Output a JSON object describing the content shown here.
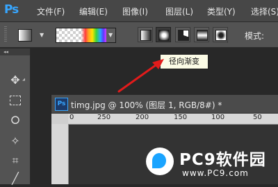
{
  "menubar": {
    "logo": "Ps",
    "items": [
      "文件(F)",
      "编辑(E)",
      "图像(I)",
      "图层(L)",
      "类型(Y)",
      "选择(S)"
    ]
  },
  "options": {
    "tooltip": "径向渐变",
    "mode_label": "模式:",
    "gradient_types": [
      "linear-gradient-icon",
      "radial-gradient-icon",
      "angle-gradient-icon",
      "reflected-gradient-icon",
      "diamond-gradient-icon"
    ],
    "selected_type": "radial-gradient-icon"
  },
  "toolbar": {
    "collapse": "◂◂",
    "tools": [
      "move-tool-icon",
      "marquee-tool-icon",
      "lasso-tool-icon",
      "magic-wand-tool-icon",
      "crop-tool-icon",
      "eyedropper-tool-icon"
    ]
  },
  "document": {
    "icon": "Ps",
    "title": "timg.jpg @ 100% (图层 1, RGB/8#) *",
    "ruler_labels": [
      "0",
      "250",
      "200",
      "150",
      "100",
      "50"
    ]
  },
  "watermark": {
    "name": "PC9软件园",
    "url": "www.PC9.com"
  },
  "colors": {
    "ps_blue": "#37a6ff",
    "arrow_red": "#e21b1b",
    "tooltip_bg": "#fbfbe6"
  }
}
